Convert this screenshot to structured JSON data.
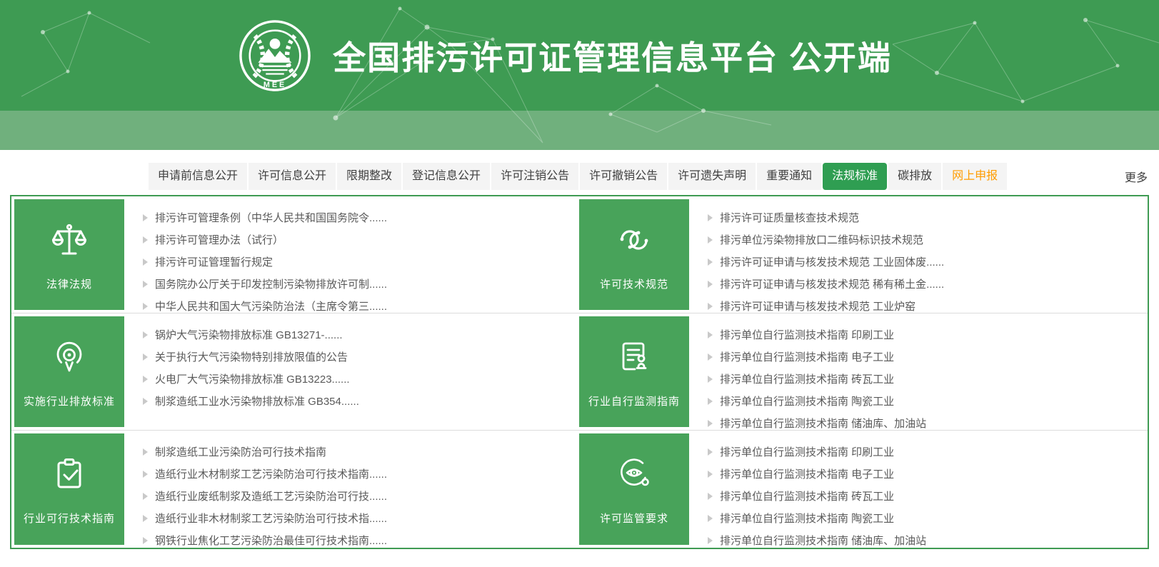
{
  "header": {
    "title": "全国排污许可证管理信息平台  公开端",
    "logo_text": "MEE"
  },
  "nav": {
    "tabs": [
      {
        "label": "申请前信息公开",
        "active": false,
        "highlight": false
      },
      {
        "label": "许可信息公开",
        "active": false,
        "highlight": false
      },
      {
        "label": "限期整改",
        "active": false,
        "highlight": false
      },
      {
        "label": "登记信息公开",
        "active": false,
        "highlight": false
      },
      {
        "label": "许可注销公告",
        "active": false,
        "highlight": false
      },
      {
        "label": "许可撤销公告",
        "active": false,
        "highlight": false
      },
      {
        "label": "许可遗失声明",
        "active": false,
        "highlight": false
      },
      {
        "label": "重要通知",
        "active": false,
        "highlight": false
      },
      {
        "label": "法规标准",
        "active": true,
        "highlight": false
      },
      {
        "label": "碳排放",
        "active": false,
        "highlight": false
      },
      {
        "label": "网上申报",
        "active": false,
        "highlight": true
      }
    ],
    "more_label": "更多"
  },
  "sections": [
    {
      "id": "laws",
      "label": "法律法规",
      "icon": "scales-icon",
      "items": [
        "排污许可管理条例（中华人民共和国国务院令......",
        "排污许可管理办法（试行）",
        "排污许可证管理暂行规定",
        "国务院办公厅关于印发控制污染物排放许可制......",
        "中华人民共和国大气污染防治法（主席令第三......"
      ]
    },
    {
      "id": "tech-specs",
      "label": "许可技术规范",
      "icon": "chain-link-icon",
      "items": [
        "排污许可证质量核查技术规范",
        "排污单位污染物排放口二维码标识技术规范",
        "排污许可证申请与核发技术规范 工业固体废......",
        "排污许可证申请与核发技术规范 稀有稀土金......",
        "排污许可证申请与核发技术规范 工业炉窑"
      ]
    },
    {
      "id": "emission-standards",
      "label": "实施行业排放标准",
      "icon": "beacon-icon",
      "items": [
        "锅炉大气污染物排放标准 GB13271-......",
        "关于执行大气污染物特别排放限值的公告",
        "火电厂大气污染物排放标准 GB13223......",
        "制浆造纸工业水污染物排放标准 GB354......"
      ]
    },
    {
      "id": "self-monitoring",
      "label": "行业自行监测指南",
      "icon": "document-stamp-icon",
      "items": [
        "排污单位自行监测技术指南 印刷工业",
        "排污单位自行监测技术指南 电子工业",
        "排污单位自行监测技术指南 砖瓦工业",
        "排污单位自行监测技术指南 陶瓷工业",
        "排污单位自行监测技术指南 储油库、加油站"
      ]
    },
    {
      "id": "feasible-tech",
      "label": "行业可行技术指南",
      "icon": "clipboard-check-icon",
      "items": [
        "制浆造纸工业污染防治可行技术指南",
        "造纸行业木材制浆工艺污染防治可行技术指南......",
        "造纸行业废纸制浆及造纸工艺污染防治可行技......",
        "造纸行业非木材制浆工艺污染防治可行技术指......",
        "钢铁行业焦化工艺污染防治最佳可行技术指南......"
      ]
    },
    {
      "id": "supervision",
      "label": "许可监管要求",
      "icon": "eye-monitor-icon",
      "items": [
        "排污单位自行监测技术指南 印刷工业",
        "排污单位自行监测技术指南 电子工业",
        "排污单位自行监测技术指南 砖瓦工业",
        "排污单位自行监测技术指南 陶瓷工业",
        "排污单位自行监测技术指南 储油库、加油站"
      ]
    }
  ],
  "colors": {
    "header_green": "#3e9b53",
    "band_green": "#70b07d",
    "card_green": "#48a35a",
    "active_tab_green": "#2f9e52",
    "tab_bg": "#f4f4f4",
    "highlight_orange": "#ff9c00",
    "content_border": "#3f9b53",
    "link_text": "#595959"
  }
}
